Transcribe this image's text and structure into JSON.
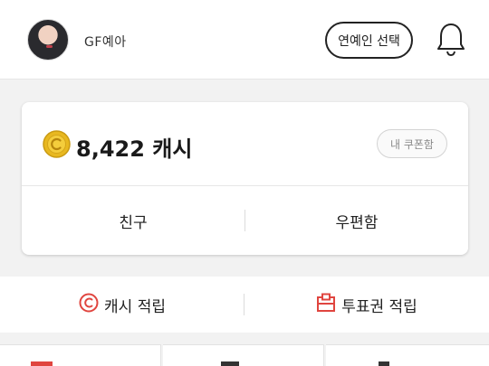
{
  "header": {
    "username": "GF예아",
    "celeb_select_label": "연예인 선택"
  },
  "wallet": {
    "cash_amount": "8,422 캐시",
    "coupon_label": "내 쿠폰함",
    "tabs": [
      {
        "label": "친구"
      },
      {
        "label": "우편함"
      }
    ]
  },
  "earn": {
    "cash_earn_label": "캐시 적립",
    "vote_earn_label": "투표권 적립"
  },
  "colors": {
    "accent_red": "#e0453f",
    "coin_gold": "#e8b820",
    "background": "#f2f2f2"
  },
  "icons": [
    "avatar",
    "bell-icon",
    "coin-icon",
    "cash-earn-icon",
    "ticket-icon"
  ]
}
